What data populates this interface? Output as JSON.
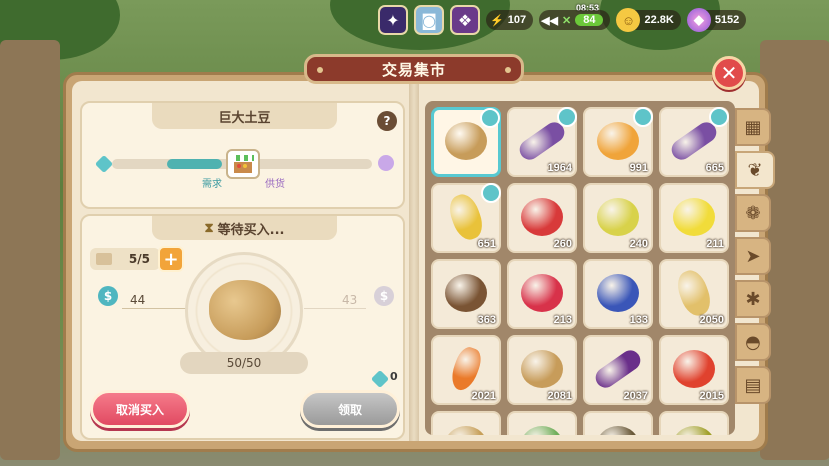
{
  "hud": {
    "time": "08:53",
    "energy": "107",
    "stamina": "84",
    "coins": "22.8K",
    "gems": "5152"
  },
  "panel": {
    "title": "交易集市",
    "item_name": "巨大土豆",
    "demand_label": "需求",
    "supply_label": "供货",
    "waiting_label": "等待买入...",
    "quantity": "5/5",
    "buy_price": "44",
    "sell_price": "43",
    "progress": "50/50",
    "cube_count": "0",
    "cancel_button": "取消买入",
    "claim_button": "领取"
  },
  "inventory": [
    {
      "name": "potato",
      "count": "",
      "tagged": true,
      "selected": true,
      "color": "#c79c5a"
    },
    {
      "name": "sugarcane",
      "count": "1964",
      "tagged": true,
      "color": "#7a4fa3"
    },
    {
      "name": "pineapple",
      "count": "991",
      "tagged": true,
      "color": "#f0a43a"
    },
    {
      "name": "sugarcane",
      "count": "665",
      "tagged": true,
      "color": "#7a4fa3"
    },
    {
      "name": "corn",
      "count": "651",
      "tagged": true,
      "color": "#e9c23a"
    },
    {
      "name": "apple",
      "count": "260",
      "color": "#d83a3a"
    },
    {
      "name": "pear",
      "count": "240",
      "color": "#d8d24a"
    },
    {
      "name": "lemon",
      "count": "211",
      "color": "#f1dc3a"
    },
    {
      "name": "coconut",
      "count": "363",
      "color": "#7a5434"
    },
    {
      "name": "raspberry",
      "count": "213",
      "color": "#d8324a"
    },
    {
      "name": "blueberry",
      "count": "133",
      "color": "#3a56b8"
    },
    {
      "name": "wheat",
      "count": "2050",
      "color": "#e2c06a"
    },
    {
      "name": "carrot",
      "count": "2021",
      "color": "#ea7a2a"
    },
    {
      "name": "potato",
      "count": "2081",
      "color": "#c79c5a"
    },
    {
      "name": "eggplant",
      "count": "2037",
      "color": "#6a2f8a"
    },
    {
      "name": "tomato",
      "count": "2015",
      "color": "#e0422e"
    },
    {
      "name": "item",
      "count": "",
      "color": "#c7a05a"
    },
    {
      "name": "item",
      "count": "",
      "color": "#6fae5a"
    },
    {
      "name": "item",
      "count": "",
      "color": "#6a5a3a"
    },
    {
      "name": "item",
      "count": "",
      "color": "#a0a02a"
    }
  ],
  "tabs": [
    "grid-icon",
    "crops-icon",
    "livestock-icon",
    "fish-icon",
    "bug-icon",
    "shell-icon",
    "misc-icon"
  ]
}
